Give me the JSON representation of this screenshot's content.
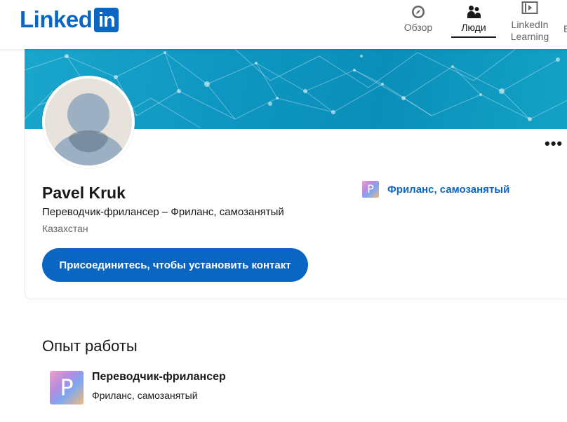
{
  "header": {
    "logo_text": "Linked",
    "logo_box": "in",
    "nav": [
      {
        "label": "Обзор",
        "icon": "compass-icon"
      },
      {
        "label": "Люди",
        "icon": "people-icon"
      },
      {
        "label_line1": "LinkedIn",
        "label_line2": "Learning",
        "icon": "learning-icon"
      }
    ],
    "overflow_label": "Е"
  },
  "profile": {
    "name": "Pavel Kruk",
    "headline": "Переводчик-фрилансер – Фриланс, самозанятый",
    "location": "Казахстан",
    "connect_label": "Присоединитесь, чтобы установить контакт",
    "more_label": "•••",
    "current_company": "Фриланс, самозанятый",
    "company_logo_letter": "P"
  },
  "experience": {
    "section_title": "Опыт работы",
    "items": [
      {
        "title": "Переводчик-фрилансер",
        "company": "Фриланс, самозанятый",
        "logo_letter": "P"
      }
    ]
  },
  "colors": {
    "brand": "#0a66c2",
    "banner": "#0e97c2"
  }
}
